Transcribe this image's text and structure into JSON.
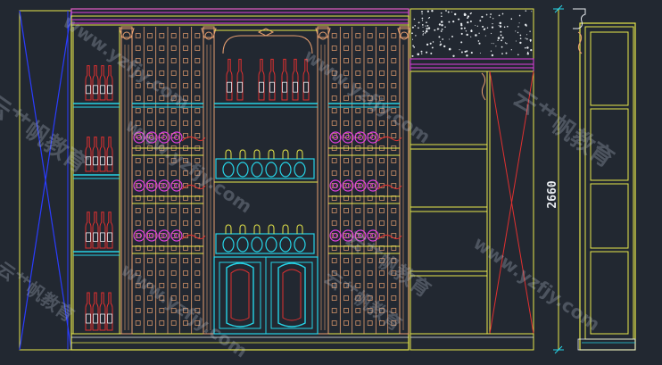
{
  "drawing": {
    "dimension_label": "2660"
  },
  "watermarks": [
    {
      "text": "云艹帆教育"
    },
    {
      "text": "www.yzfjy.com"
    },
    {
      "text": "云艹帆教育"
    },
    {
      "text": "www.yzfjy.com"
    },
    {
      "text": "云艹帆教育"
    },
    {
      "text": "www.yzfjy.com"
    },
    {
      "text": "云艹帆教育"
    },
    {
      "text": "www.yzfjy.com"
    },
    {
      "text": "云艹帆教育"
    },
    {
      "text": "www.yzfjy.com"
    }
  ],
  "colors": {
    "background": "#222831",
    "yellow": "#e8e84a",
    "cyan": "#26d3e6",
    "magenta": "#e040e0",
    "orange": "#e8a070",
    "red": "#e03030",
    "blue": "#2a3cff",
    "white": "#e8ecf0"
  }
}
